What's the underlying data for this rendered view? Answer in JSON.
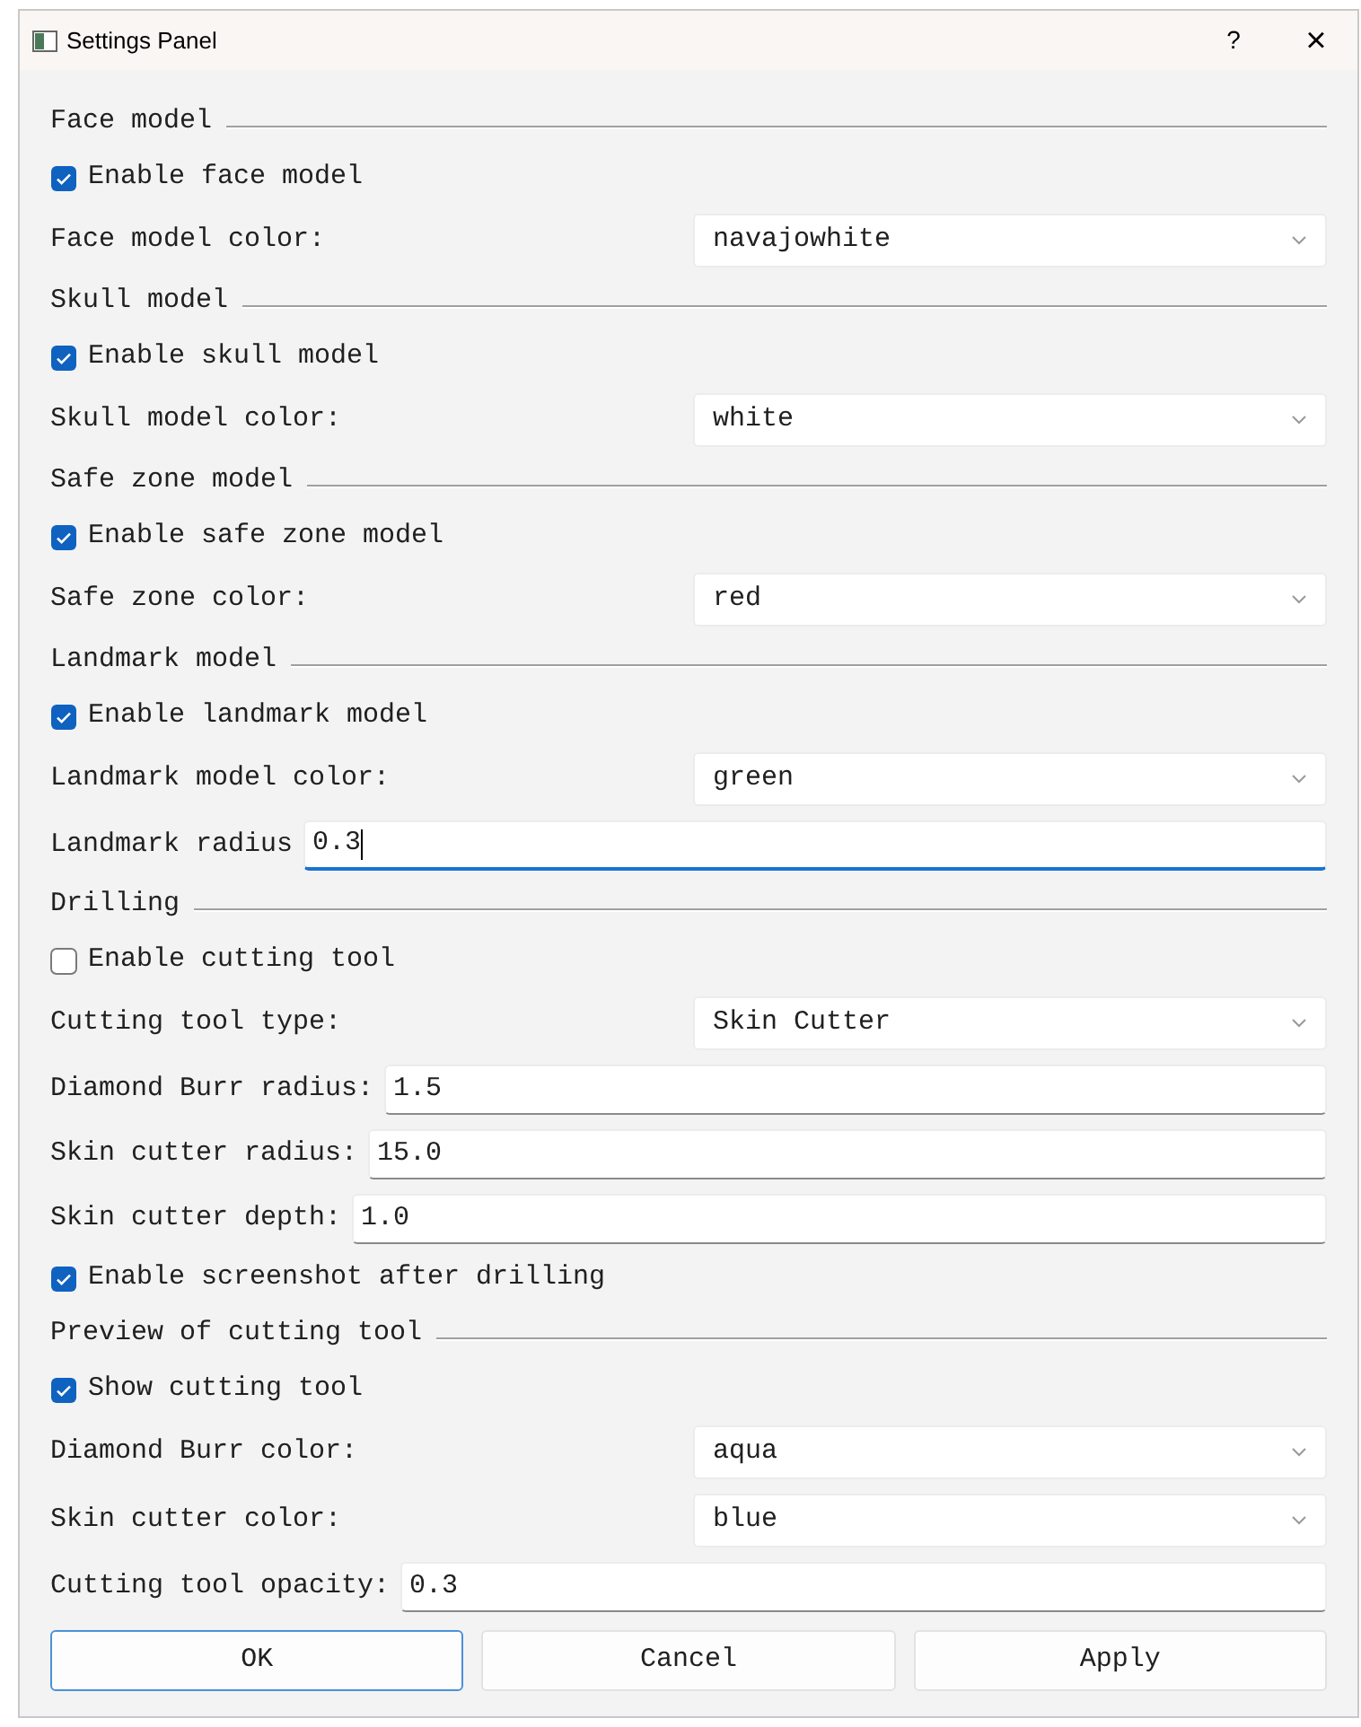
{
  "window": {
    "title": "Settings Panel",
    "help": "?",
    "close": "×"
  },
  "items": [
    {
      "kind": "group",
      "label": "Face model"
    },
    {
      "kind": "checkbox",
      "label": "Enable face model",
      "checked": true
    },
    {
      "kind": "combo",
      "label": "Face model color:",
      "value": "navajowhite"
    },
    {
      "kind": "group",
      "label": "Skull model"
    },
    {
      "kind": "checkbox",
      "label": "Enable skull model",
      "checked": true
    },
    {
      "kind": "combo",
      "label": "Skull model color:",
      "value": "white"
    },
    {
      "kind": "group",
      "label": "Safe zone model"
    },
    {
      "kind": "checkbox",
      "label": "Enable safe zone model",
      "checked": true
    },
    {
      "kind": "combo",
      "label": "Safe zone color:",
      "value": "red"
    },
    {
      "kind": "group",
      "label": "Landmark model"
    },
    {
      "kind": "checkbox",
      "label": "Enable landmark model",
      "checked": true
    },
    {
      "kind": "combo",
      "label": "Landmark model color:",
      "value": "green"
    },
    {
      "kind": "field",
      "label": "Landmark radius",
      "value": "0.3",
      "focused": true
    },
    {
      "kind": "group",
      "label": "Drilling"
    },
    {
      "kind": "checkbox",
      "label": "Enable cutting tool",
      "checked": false
    },
    {
      "kind": "combo",
      "label": "Cutting tool type:",
      "value": "Skin Cutter"
    },
    {
      "kind": "field",
      "label": "Diamond Burr radius:",
      "value": "1.5",
      "focused": false
    },
    {
      "kind": "field",
      "label": "Skin cutter radius:",
      "value": "15.0",
      "focused": false
    },
    {
      "kind": "field",
      "label": "Skin cutter depth:",
      "value": "1.0",
      "focused": false
    },
    {
      "kind": "checkbox",
      "label": "Enable screenshot after drilling",
      "checked": true
    },
    {
      "kind": "group",
      "label": "Preview of cutting tool"
    },
    {
      "kind": "checkbox",
      "label": "Show cutting tool",
      "checked": true
    },
    {
      "kind": "combo",
      "label": "Diamond Burr color:",
      "value": "aqua"
    },
    {
      "kind": "combo",
      "label": "Skin cutter color:",
      "value": "blue"
    },
    {
      "kind": "field",
      "label": "Cutting tool opacity:",
      "value": "0.3",
      "focused": false
    }
  ],
  "buttons": [
    {
      "label": "OK",
      "default": true
    },
    {
      "label": "Cancel",
      "default": false
    },
    {
      "label": "Apply",
      "default": false
    }
  ]
}
